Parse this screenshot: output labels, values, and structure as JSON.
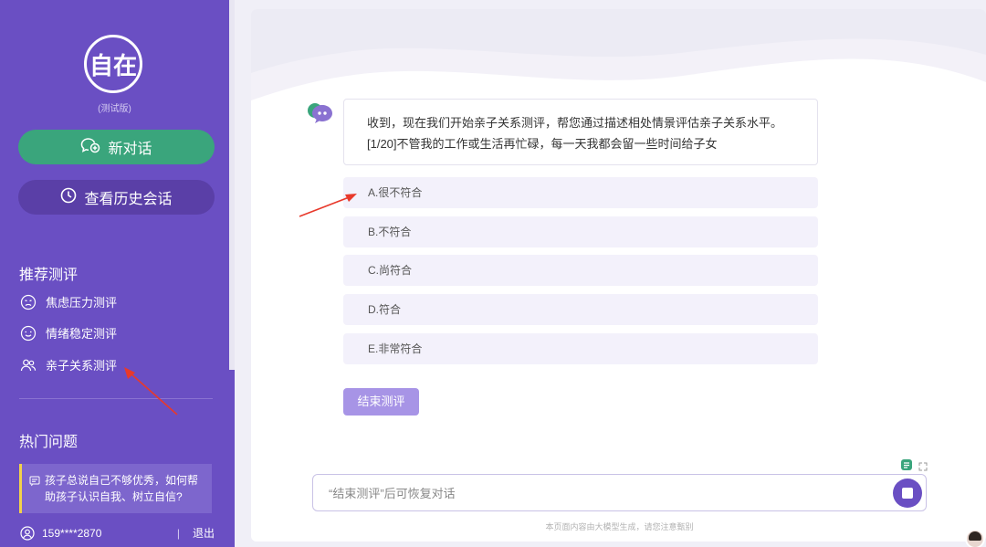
{
  "sidebar": {
    "logo_text": "自在",
    "logo_subtitle": "(测试版)",
    "new_chat_label": "新对话",
    "history_label": "查看历史会话",
    "recommended_title": "推荐测评",
    "recommended_items": [
      {
        "label": "焦虑压力测评",
        "icon": "anxious-face-icon"
      },
      {
        "label": "情绪稳定测评",
        "icon": "smile-face-icon"
      },
      {
        "label": "亲子关系测评",
        "icon": "people-icon"
      }
    ],
    "hot_title": "热门问题",
    "hot_question": "孩子总说自己不够优秀，如何帮助孩子认识自我、树立自信?",
    "user_phone": "159****2870",
    "separator": "|",
    "logout_label": "退出"
  },
  "chat": {
    "bot_message_line1": "收到，现在我们开始亲子关系测评，帮您通过描述相处情景评估亲子关系水平。",
    "bot_message_line2": "[1/20]不管我的工作或生活再忙碌，每一天我都会留一些时间给子女",
    "options": [
      "A.很不符合",
      "B.不符合",
      "C.尚符合",
      "D.符合",
      "E.非常符合"
    ],
    "end_button_label": "结束测评"
  },
  "input": {
    "placeholder": "“结束测评”后可恢复对话",
    "disclaimer": "本页面内容由大模型生成，请您注意甄别"
  },
  "colors": {
    "sidebar_bg": "#6a4fc3",
    "new_chat_bg": "#3aa57c",
    "accent_light": "#a794e6",
    "annotation_arrow": "#e8392b"
  }
}
